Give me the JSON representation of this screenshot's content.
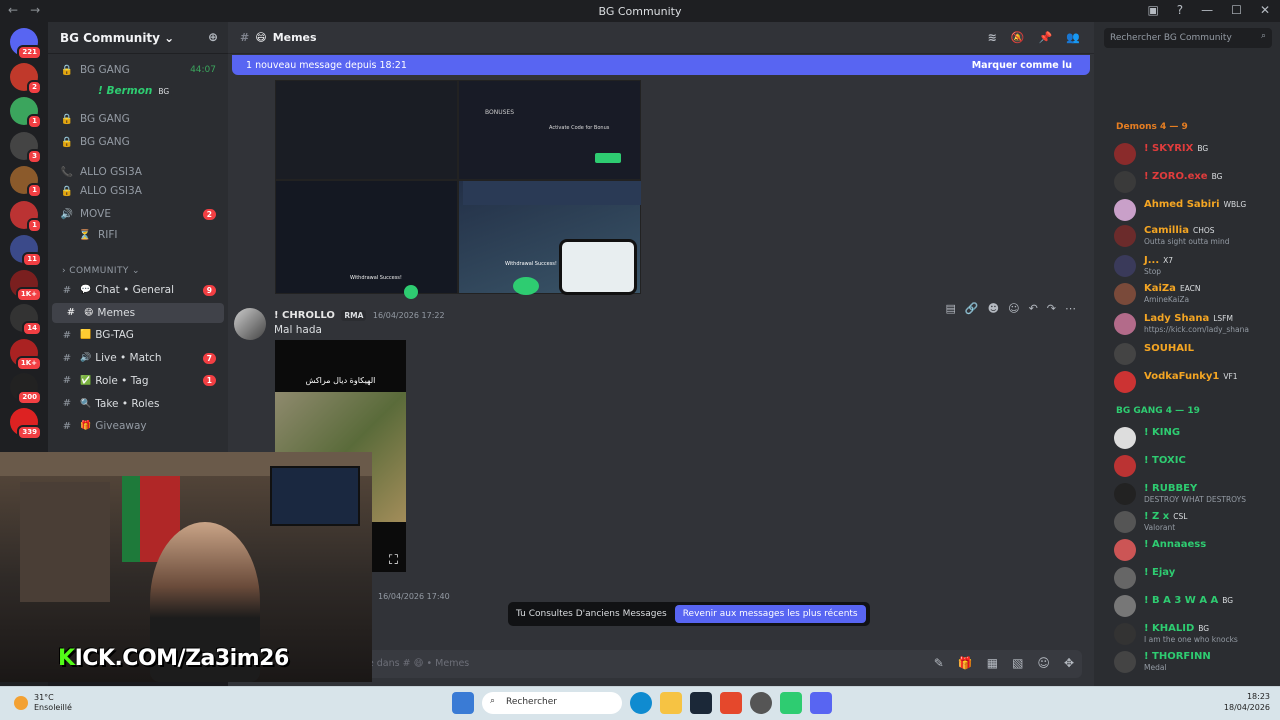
{
  "window": {
    "title": "BG Community"
  },
  "servers": [
    {
      "badge": "221",
      "color": "#5865f2"
    },
    {
      "badge": "2",
      "color": "#c0392b"
    },
    {
      "badge": "1",
      "color": "#3ba55d"
    },
    {
      "badge": "3",
      "color": "#444"
    },
    {
      "badge": "1",
      "color": "#8b5a2b"
    },
    {
      "badge": "1",
      "color": "#b33"
    },
    {
      "badge": "11",
      "color": "#3b4a8a"
    },
    {
      "badge": "1K+",
      "color": "#7a1f1f"
    },
    {
      "badge": "14",
      "color": "#333"
    },
    {
      "badge": "1K+",
      "color": "#a22"
    },
    {
      "badge": "200",
      "color": "#222"
    },
    {
      "badge": "339",
      "color": "#d22"
    }
  ],
  "sidebar": {
    "guild_name": "BG Community",
    "voice": [
      {
        "label": "BG GANG",
        "time": "44:07"
      },
      {
        "label": "! Bermon",
        "tag": "BG"
      },
      {
        "label": "BG GANG"
      },
      {
        "label": "BG GANG"
      },
      {
        "label": "ALLO GSI3A"
      },
      {
        "label": "ALLO GSI3A"
      },
      {
        "label": "MOVE",
        "badge": "2"
      },
      {
        "label": "RIFI"
      }
    ],
    "category": "COMMUNITY",
    "channels": [
      {
        "label": "Chat • General",
        "badge": "9"
      },
      {
        "label": "Memes",
        "active": true
      },
      {
        "label": "BG-TAG"
      },
      {
        "label": "Live • Match",
        "badge": "7"
      },
      {
        "label": "Role • Tag",
        "badge": "1"
      },
      {
        "label": "Take • Roles"
      },
      {
        "label": "Giveaway"
      }
    ]
  },
  "chat": {
    "channel": "Memes",
    "new_messages": "1 nouveau message depuis 18:21",
    "mark_read": "Marquer comme lu",
    "message": {
      "author": "! CHROLLO",
      "tag": "RMA",
      "timestamp": "16/04/2026 17:22",
      "text": "Mal hada",
      "video_caption": "الهيكاوة ديال مراكش"
    },
    "next_timestamp": "16/04/2026 17:40",
    "older_notice": "Tu Consultes D'anciens Messages",
    "back_button": "Revenir aux messages les plus récents",
    "composer_placeholder": "un message dans #",
    "composer_channel": "Memes",
    "screenshot_texts": [
      "BONUSES",
      "Activate Code for Bonus",
      "Withdrawal Success!",
      "Withdrawal Success!"
    ]
  },
  "members": {
    "search_placeholder": "Rechercher BG Community",
    "groups": [
      {
        "title": "Demons 4 — 9",
        "color": "#e67e22"
      },
      {
        "title": "BG GANG 4 — 19",
        "color": "#2ecc71"
      }
    ],
    "list": [
      {
        "name": "! SKYRIX",
        "tag": "BG",
        "color": "#e03c3c"
      },
      {
        "name": "! ZORO.exe",
        "tag": "BG",
        "color": "#e03c3c"
      },
      {
        "name": "Ahmed Sabiri",
        "tag": "WBLG",
        "color": "#f5a623"
      },
      {
        "name": "Camillia",
        "tag": "CHOS",
        "status": "Outta sight outta mind",
        "color": "#f5a623"
      },
      {
        "name": "J...",
        "tag": "X7",
        "status": "Stop",
        "color": "#f5a623"
      },
      {
        "name": "KaiZa",
        "tag": "EACN",
        "status": "AmineKaiZa",
        "color": "#f5a623"
      },
      {
        "name": "Lady Shana",
        "tag": "LSFM",
        "status": "https://kick.com/lady_shana",
        "color": "#f5a623"
      },
      {
        "name": "SOUHAIL",
        "color": "#f5a623"
      },
      {
        "name": "VodkaFunky1",
        "tag": "VF1",
        "color": "#f5a623"
      },
      {
        "name": "! KING",
        "color": "#2ecc71"
      },
      {
        "name": "! TOXIC",
        "color": "#2ecc71"
      },
      {
        "name": "! RUBBEY",
        "status": "DESTROY WHAT DESTROYS",
        "color": "#2ecc71"
      },
      {
        "name": "! Z x",
        "tag": "CSL",
        "status": "Valorant",
        "color": "#2ecc71"
      },
      {
        "name": "! Annaaess",
        "color": "#2ecc71"
      },
      {
        "name": "! Ejay",
        "color": "#2ecc71"
      },
      {
        "name": "! B A 3 W A A",
        "tag": "BG",
        "color": "#2ecc71"
      },
      {
        "name": "! KHALID",
        "tag": "BG",
        "status": "I am the one who knocks",
        "color": "#2ecc71"
      },
      {
        "name": "! THORFINN",
        "status": "Medal",
        "color": "#2ecc71"
      }
    ]
  },
  "stream": {
    "overlay": "KICK.COM/Za3im26",
    "overlay_k": "K"
  },
  "taskbar": {
    "weather_temp": "31°C",
    "weather_text": "Ensoleillé",
    "search": "Rechercher",
    "time": "18:23",
    "date": "18/04/2026"
  }
}
